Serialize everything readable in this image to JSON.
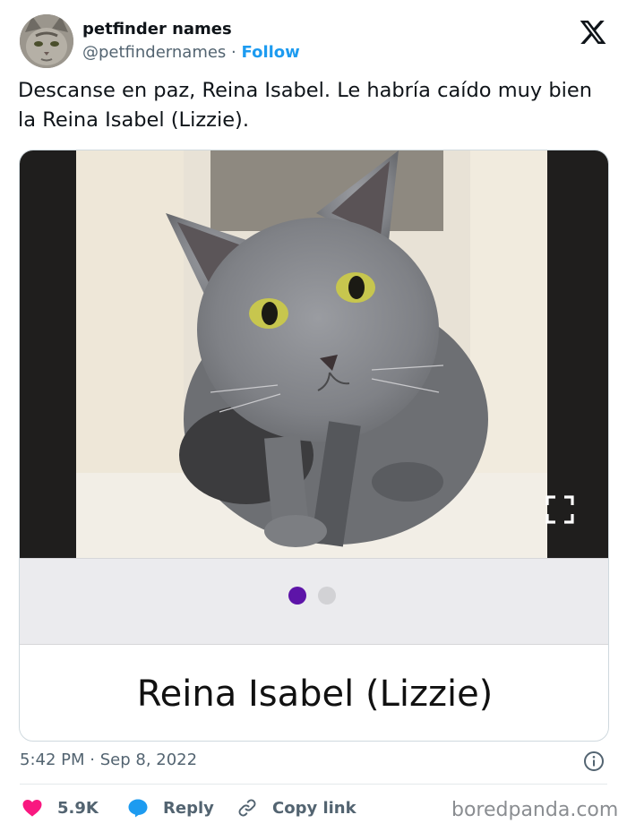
{
  "author": {
    "name": "petfinder names",
    "handle": "@petfindernames",
    "separator": "·",
    "follow_label": "Follow"
  },
  "tweet": {
    "text": "Descanse en paz, Reina Isabel. Le habría caído muy bien la Reina Isabel (Lizzie)."
  },
  "card": {
    "caption": "Reina Isabel (Lizzie)",
    "carousel_total": 2,
    "carousel_active": 1
  },
  "meta": {
    "time": "5:42 PM",
    "separator": "·",
    "date": "Sep 8, 2022"
  },
  "actions": {
    "likes": "5.9K",
    "reply_label": "Reply",
    "copy_link_label": "Copy link"
  },
  "watermark": "boredpanda.com",
  "icons": {
    "logo": "x-logo-icon",
    "info": "info-icon",
    "like": "heart-icon",
    "reply": "speech-bubble-icon",
    "copy": "link-icon",
    "expand": "expand-icon"
  },
  "colors": {
    "follow": "#1d9bf0",
    "like": "#f91880",
    "reply": "#1d9bf0",
    "carousel_active": "#5d14a8"
  }
}
